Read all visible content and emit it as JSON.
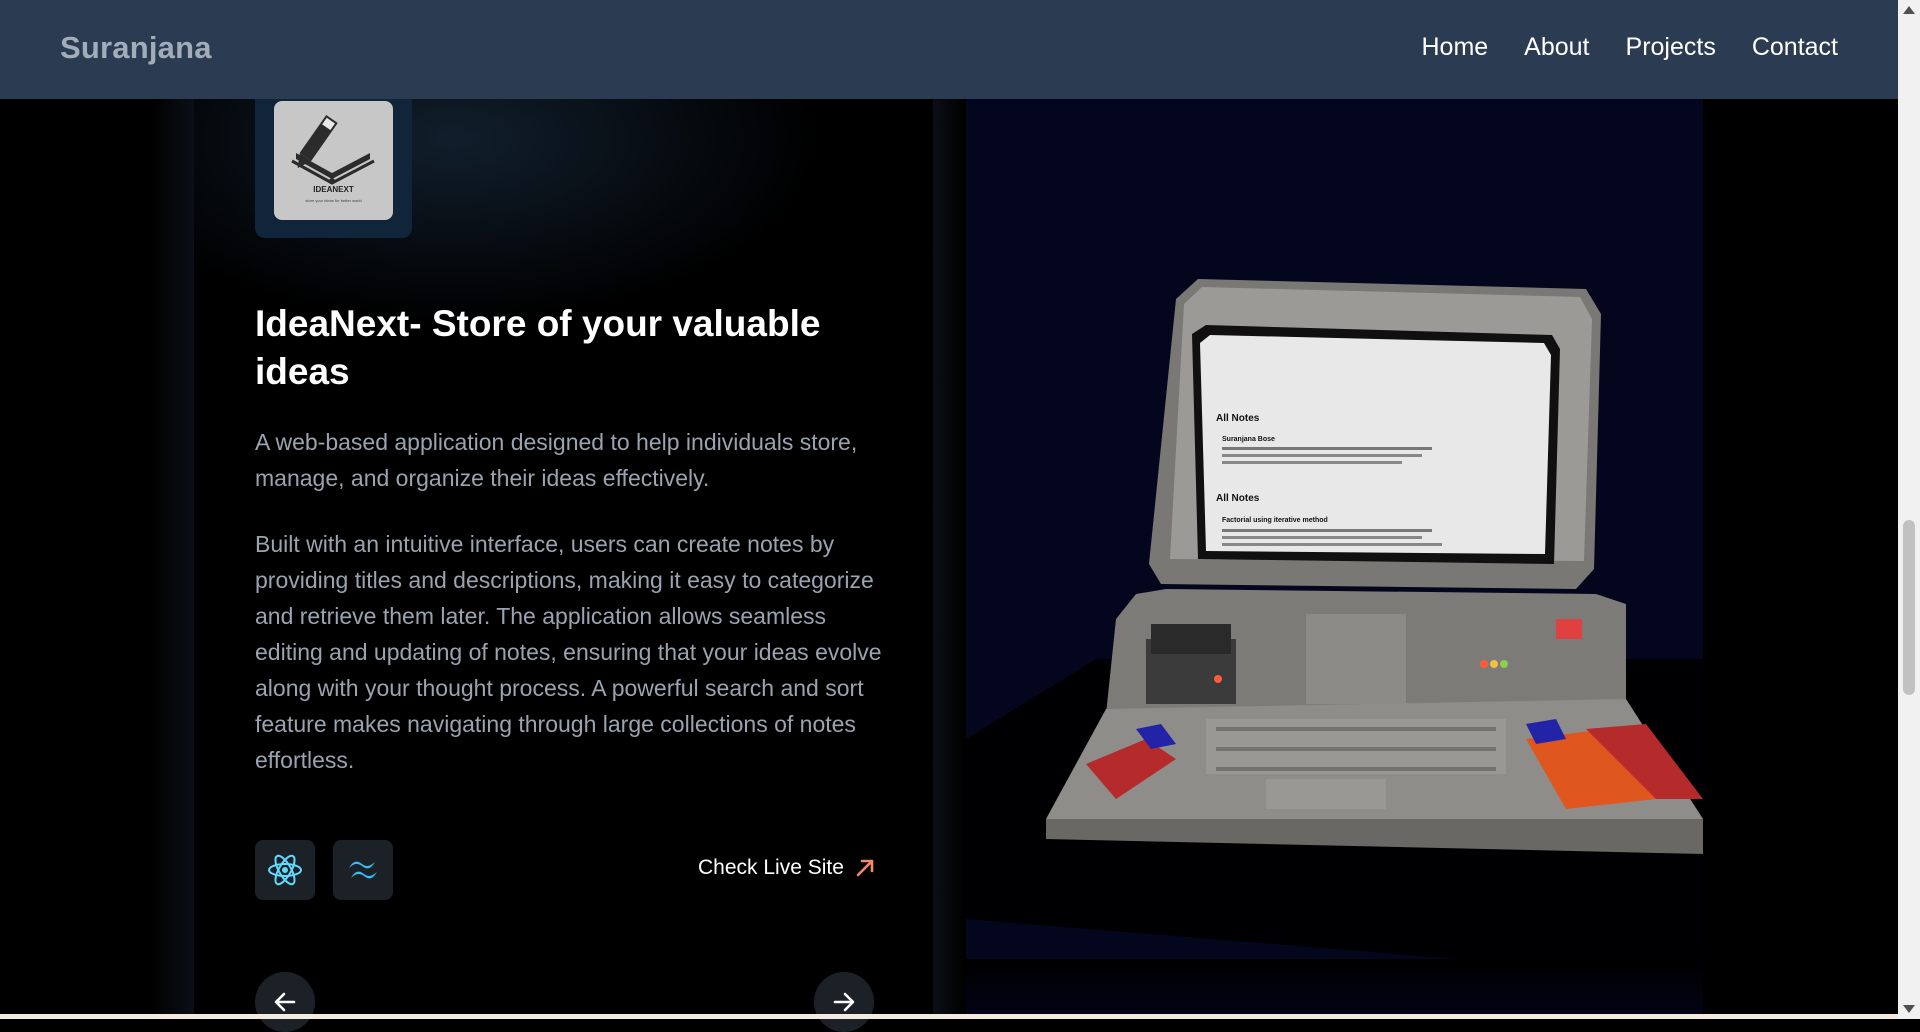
{
  "navbar": {
    "brand": "Suranjana",
    "links": [
      "Home",
      "About",
      "Projects",
      "Contact"
    ]
  },
  "project": {
    "logo_name": "IDEANEXT",
    "logo_tagline": "store your ideas for better world",
    "title": "IdeaNext- Store of your valuable ideas",
    "description_1": "A web-based application designed to help individuals store, manage, and organize their ideas effectively.",
    "description_2": "Built with an intuitive interface, users can create notes by providing titles and descriptions, making it easy to categorize and retrieve them later. The application allows seamless editing and updating of notes, ensuring that your ideas evolve along with your thought process. A powerful search and sort feature makes navigating through large collections of notes effortless.",
    "tech_icons": [
      "react-icon",
      "tailwind-icon"
    ],
    "live_link_label": "Check Live Site",
    "prev_icon": "arrow-left-icon",
    "next_icon": "arrow-right-icon"
  },
  "screen": {
    "heading_1": "All Notes",
    "note_1_title": "Suranjana Bose",
    "heading_2": "All Notes",
    "note_2_title": "Factorial using iterative method"
  },
  "colors": {
    "navbar_bg": "#2b3c52",
    "brand": "#a3adba",
    "scene_bg": "#04061e",
    "accent_arrow": "#f58a68",
    "react_blue": "#61dafb",
    "tailwind_blue": "#38bdf8"
  }
}
